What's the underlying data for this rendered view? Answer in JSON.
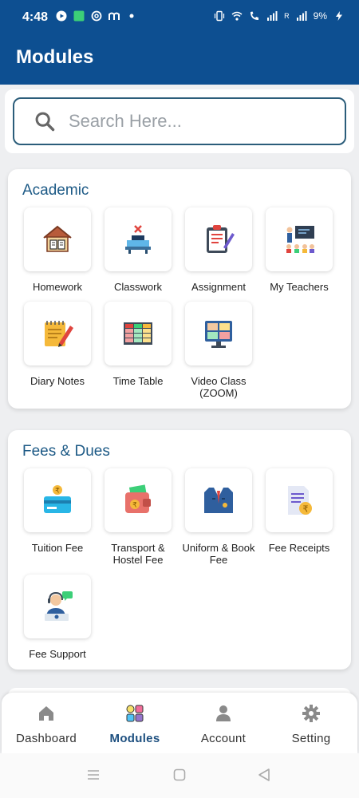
{
  "status_bar": {
    "time": "4:48",
    "battery": "9%",
    "network": "R"
  },
  "app_bar": {
    "title": "Modules"
  },
  "search": {
    "placeholder": "Search Here..."
  },
  "sections": [
    {
      "title": "Academic",
      "items": [
        {
          "label": "Homework",
          "icon": "house-book-icon"
        },
        {
          "label": "Classwork",
          "icon": "classroom-desk-icon"
        },
        {
          "label": "Assignment",
          "icon": "clipboard-icon"
        },
        {
          "label": "My Teachers",
          "icon": "teacher-board-icon"
        },
        {
          "label": "Diary Notes",
          "icon": "notepad-pencil-icon"
        },
        {
          "label": "Time Table",
          "icon": "timetable-icon"
        },
        {
          "label": "Video Class (ZOOM)",
          "icon": "video-conference-icon"
        }
      ]
    },
    {
      "title": "Fees & Dues",
      "items": [
        {
          "label": "Tuition Fee",
          "icon": "card-rupee-icon"
        },
        {
          "label": "Transport & Hostel Fee",
          "icon": "wallet-rupee-icon"
        },
        {
          "label": "Uniform & Book Fee",
          "icon": "uniform-icon"
        },
        {
          "label": "Fee Receipts",
          "icon": "receipt-rupee-icon"
        },
        {
          "label": "Fee Support",
          "icon": "support-agent-icon"
        }
      ]
    }
  ],
  "bottom_nav": {
    "items": [
      {
        "label": "Dashboard",
        "icon": "home-icon"
      },
      {
        "label": "Modules",
        "icon": "modules-grid-icon",
        "active": true
      },
      {
        "label": "Account",
        "icon": "person-icon"
      },
      {
        "label": "Setting",
        "icon": "gear-icon"
      }
    ]
  },
  "colors": {
    "primary": "#0d4f91",
    "section_title": "#1d5a86",
    "background": "#eeeff1"
  }
}
